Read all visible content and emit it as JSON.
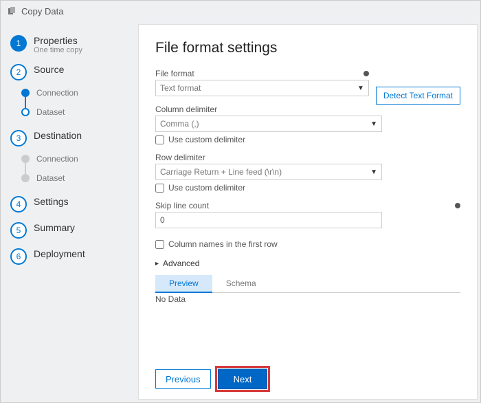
{
  "titlebar": {
    "title": "Copy Data"
  },
  "wizard": {
    "step1": {
      "num": "1",
      "title": "Properties",
      "sub": "One time copy"
    },
    "step2": {
      "num": "2",
      "title": "Source",
      "sub1": "Connection",
      "sub2": "Dataset"
    },
    "step3": {
      "num": "3",
      "title": "Destination",
      "sub1": "Connection",
      "sub2": "Dataset"
    },
    "step4": {
      "num": "4",
      "title": "Settings"
    },
    "step5": {
      "num": "5",
      "title": "Summary"
    },
    "step6": {
      "num": "6",
      "title": "Deployment"
    }
  },
  "page": {
    "title": "File format settings",
    "file_format_label": "File format",
    "file_format_value": "Text format",
    "detect_btn": "Detect Text Format",
    "col_delim_label": "Column delimiter",
    "col_delim_value": "Comma (,)",
    "col_custom_label": "Use custom delimiter",
    "row_delim_label": "Row delimiter",
    "row_delim_value": "Carriage Return + Line feed (\\r\\n)",
    "row_custom_label": "Use custom delimiter",
    "skip_label": "Skip line count",
    "skip_value": "0",
    "first_row_label": "Column names in the first row",
    "advanced_label": "Advanced",
    "tab_preview": "Preview",
    "tab_schema": "Schema",
    "nodata": "No Data",
    "prev_btn": "Previous",
    "next_btn": "Next"
  }
}
